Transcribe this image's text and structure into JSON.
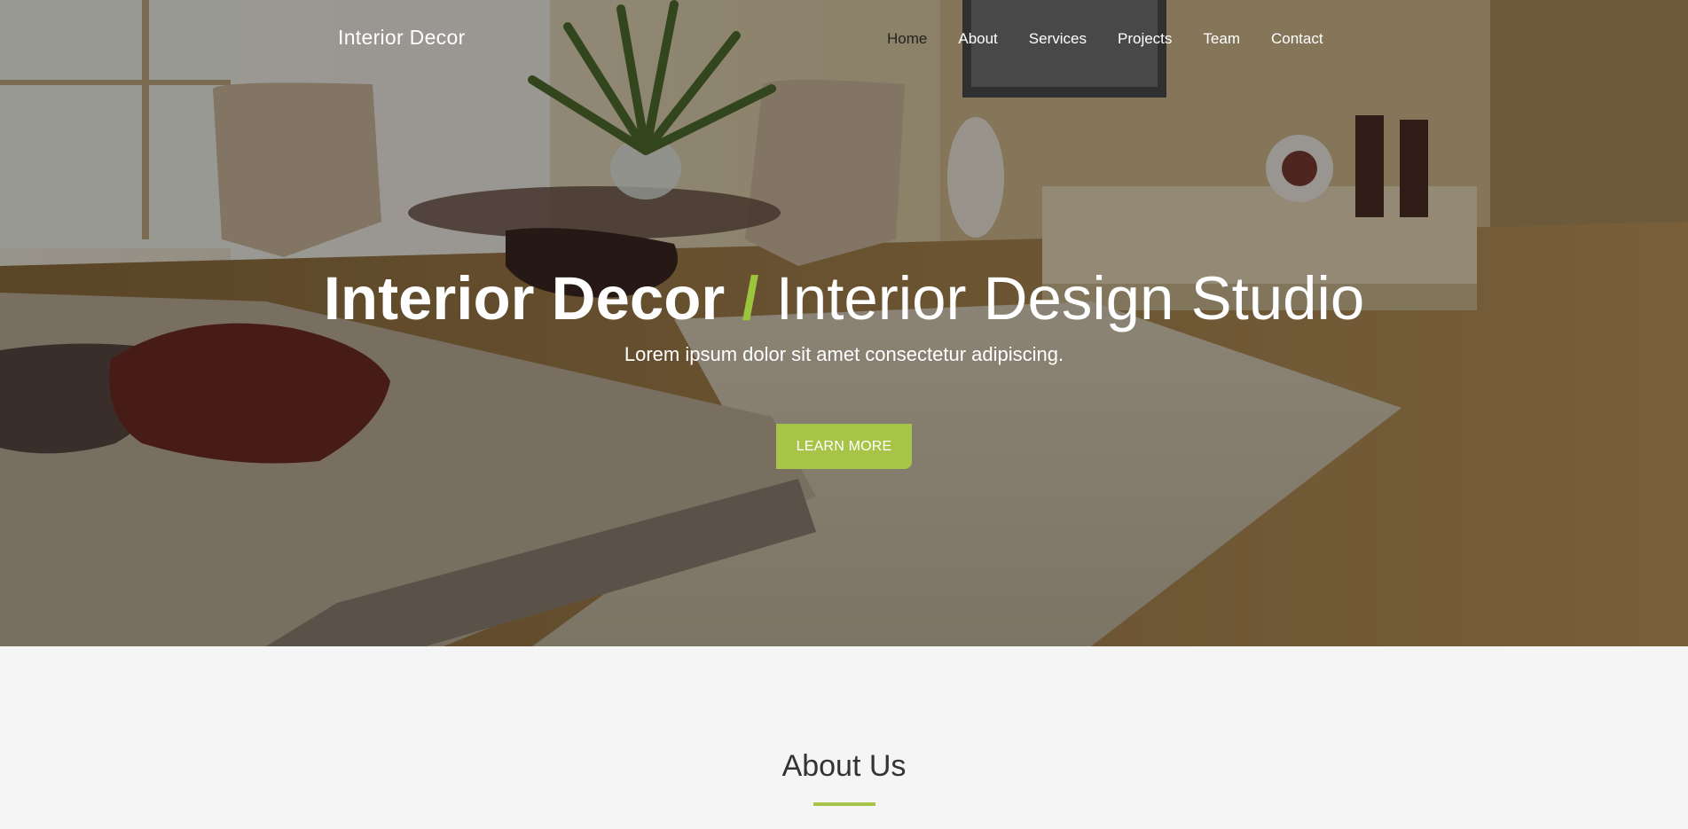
{
  "header": {
    "brand": "Interior Decor",
    "nav": [
      {
        "label": "Home",
        "active": true
      },
      {
        "label": "About",
        "active": false
      },
      {
        "label": "Services",
        "active": false
      },
      {
        "label": "Projects",
        "active": false
      },
      {
        "label": "Team",
        "active": false
      },
      {
        "label": "Contact",
        "active": false
      }
    ]
  },
  "hero": {
    "title_strong": "Interior Decor",
    "title_slash": "/",
    "title_rest": "Interior Design Studio",
    "subtitle": "Lorem ipsum dolor sit amet consectetur adipiscing.",
    "cta_label": "LEARN MORE",
    "background_icon": "bedroom-interior-photo"
  },
  "about": {
    "title": "About Us"
  },
  "colors": {
    "accent": "#a6c448",
    "accent_text": "#9bc53d",
    "section_bg": "#f5f5f5",
    "title_text": "#333333"
  }
}
